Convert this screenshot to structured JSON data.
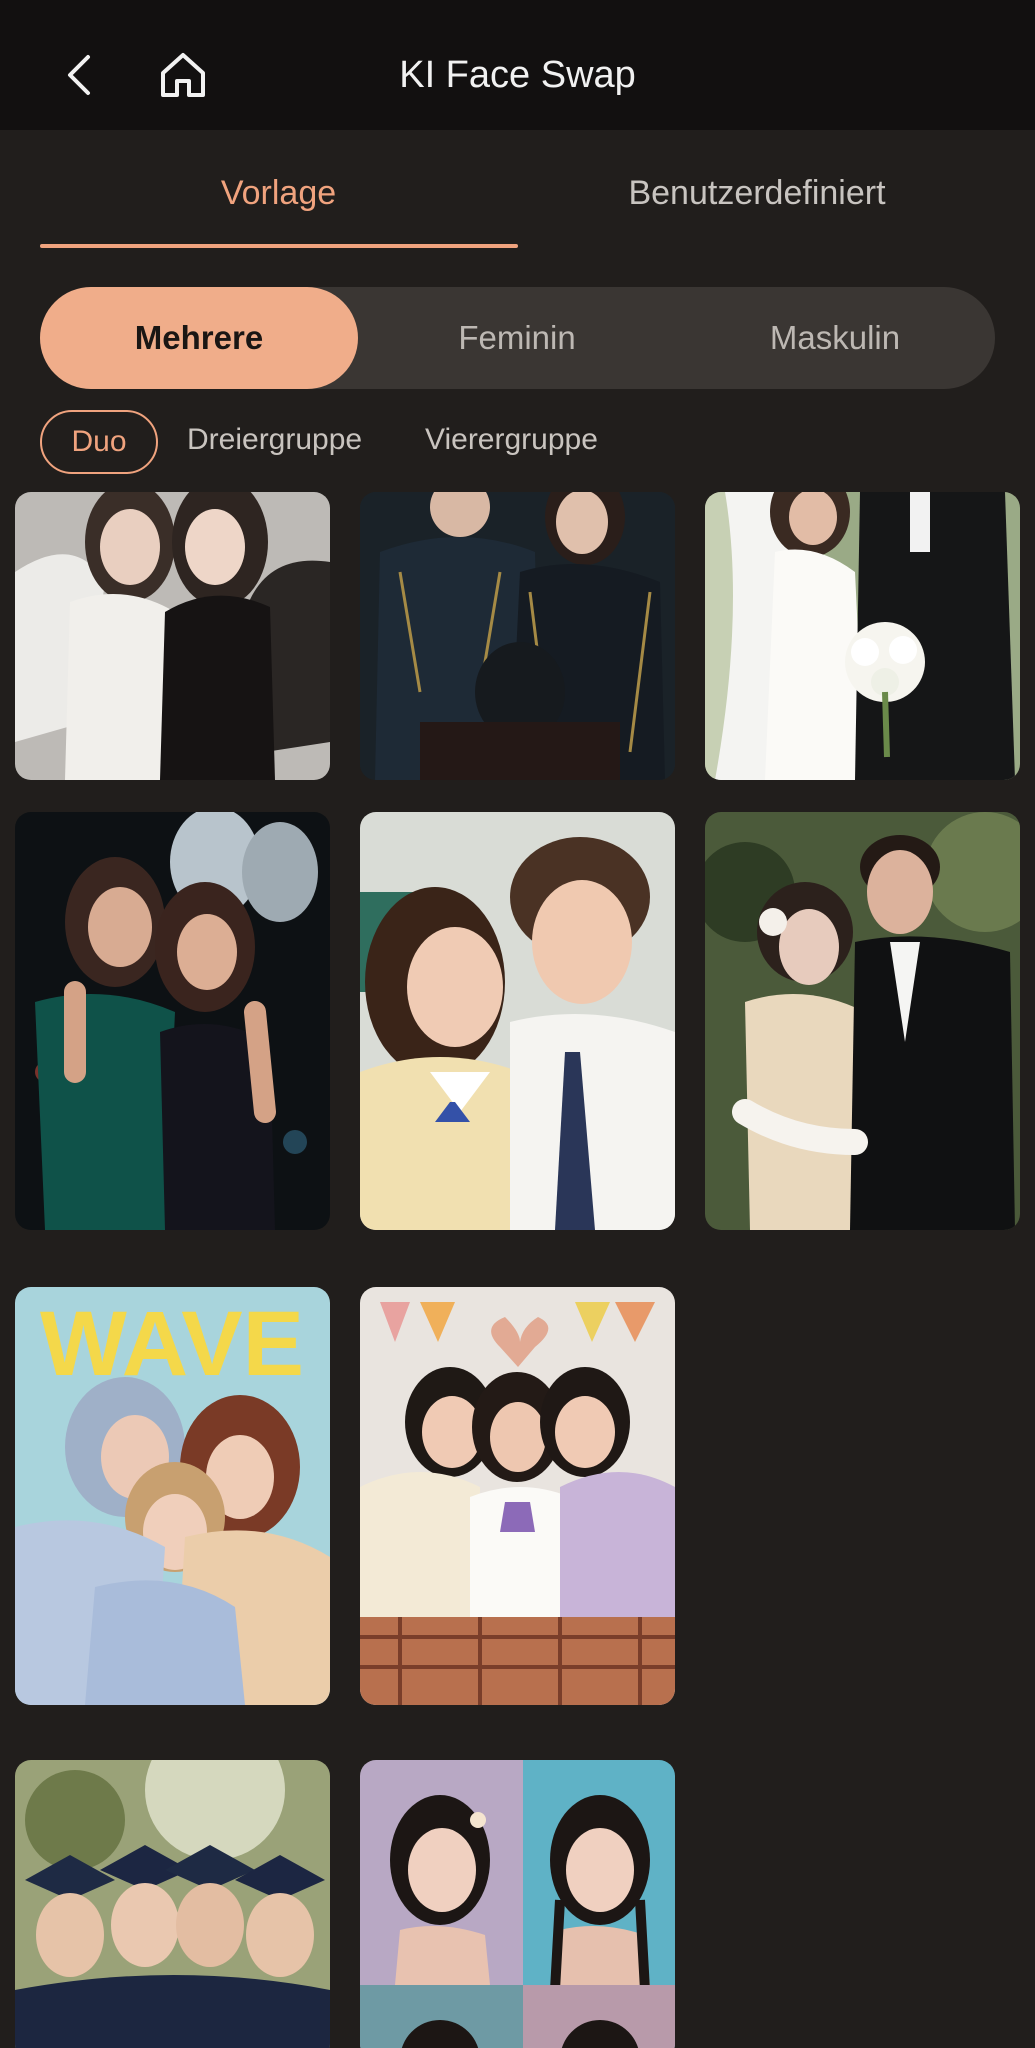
{
  "header": {
    "title": "KI Face Swap",
    "back_icon": "chevron-left-icon",
    "home_icon": "home-icon"
  },
  "main_tabs": {
    "vorlage": "Vorlage",
    "custom": "Benutzerdefiniert",
    "active": "Vorlage"
  },
  "segment": {
    "items": [
      "Mehrere",
      "Feminin",
      "Maskulin"
    ],
    "active": "Mehrere"
  },
  "chips": {
    "items": [
      "Duo",
      "Dreiergruppe",
      "Vierergruppe"
    ],
    "active": "Duo"
  },
  "templates": {
    "row3_card1_text": "WAVE"
  },
  "colors": {
    "accent": "#f0a37e",
    "background": "#211e1c",
    "topbar": "#121010"
  }
}
